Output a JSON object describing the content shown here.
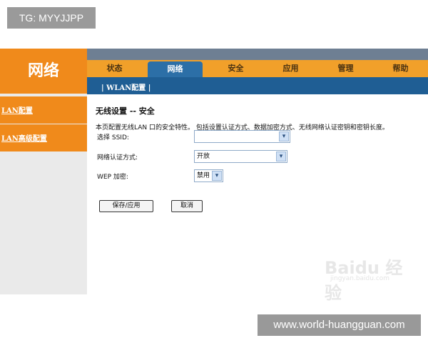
{
  "overlay": {
    "top_tag": "TG: MYYJJPP",
    "bottom_tag": "www.world-huangguan.com"
  },
  "header": {
    "logo": "网络"
  },
  "menu": [
    {
      "label": "状态"
    },
    {
      "label": "网络",
      "active": true
    },
    {
      "label": "安全"
    },
    {
      "label": "应用"
    },
    {
      "label": "管理"
    },
    {
      "label": "帮助"
    }
  ],
  "submenu": {
    "label": "| WLAN配置 |"
  },
  "sidebar": {
    "items": [
      {
        "label": "LAN配置"
      },
      {
        "label": "LAN高级配置"
      }
    ]
  },
  "form": {
    "title": "无线设置  -- 安全",
    "description": "本页配置无线LAN 口的安全特性。 包括设置认证方式、数据加密方式、无线网络认证密钥和密钥长度。",
    "ssid_label": "选择 SSID:",
    "ssid_value": "",
    "auth_label": "网络认证方式:",
    "auth_value": "开放",
    "wep_label": "WEP 加密:",
    "wep_value": "禁用",
    "save_button": "保存/应用",
    "cancel_button": "取消"
  },
  "watermark": {
    "text": "Baidu 经验",
    "sub": "jingyan.baidu.com"
  },
  "icons": {
    "dropdown": "chevron-down-icon"
  }
}
